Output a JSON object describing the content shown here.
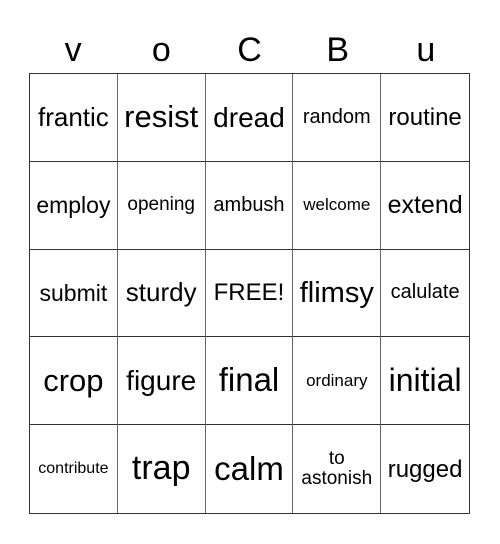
{
  "header": [
    "v",
    "o",
    "C",
    "B",
    "u"
  ],
  "cells": [
    {
      "text": "frantic",
      "size": 26
    },
    {
      "text": "resist",
      "size": 31
    },
    {
      "text": "dread",
      "size": 28
    },
    {
      "text": "random",
      "size": 20
    },
    {
      "text": "routine",
      "size": 24
    },
    {
      "text": "employ",
      "size": 23
    },
    {
      "text": "opening",
      "size": 19
    },
    {
      "text": "ambush",
      "size": 20
    },
    {
      "text": "welcome",
      "size": 17
    },
    {
      "text": "extend",
      "size": 25
    },
    {
      "text": "submit",
      "size": 23
    },
    {
      "text": "sturdy",
      "size": 26
    },
    {
      "text": "FREE!",
      "size": 24
    },
    {
      "text": "flimsy",
      "size": 29
    },
    {
      "text": "calulate",
      "size": 20
    },
    {
      "text": "crop",
      "size": 31
    },
    {
      "text": "figure",
      "size": 28
    },
    {
      "text": "final",
      "size": 33
    },
    {
      "text": "ordinary",
      "size": 17
    },
    {
      "text": "initial",
      "size": 32
    },
    {
      "text": "contribute",
      "size": 16
    },
    {
      "text": "trap",
      "size": 34
    },
    {
      "text": "calm",
      "size": 33
    },
    {
      "text": "to\nastonish",
      "size": 19
    },
    {
      "text": "rugged",
      "size": 24
    }
  ]
}
